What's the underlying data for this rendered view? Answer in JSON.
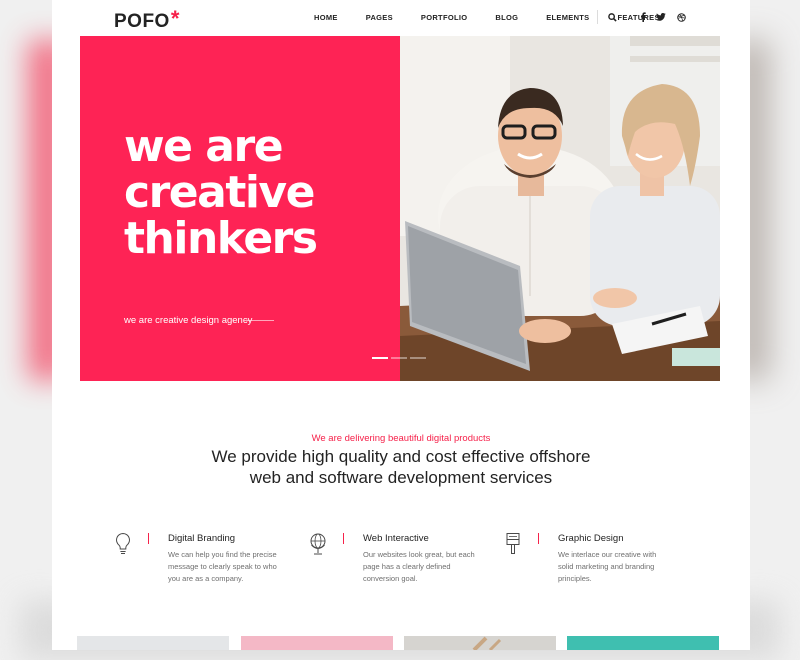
{
  "header": {
    "logo": "POFO",
    "logo_mark": "*",
    "nav": [
      "HOME",
      "PAGES",
      "PORTFOLIO",
      "BLOG",
      "ELEMENTS",
      "FEATURES"
    ],
    "icons": [
      "search-icon",
      "facebook-icon",
      "twitter-icon",
      "dribbble-icon"
    ]
  },
  "hero": {
    "title_lines": [
      "we are",
      "creative",
      "thinkers"
    ],
    "subtitle": "we are creative design agency",
    "slides": 3,
    "active_slide": 1,
    "accent_color": "#fe2355"
  },
  "intro": {
    "kicker": "We are delivering beautiful digital products",
    "title_lines": [
      "We provide high quality and cost effective offshore",
      "web and software development services"
    ]
  },
  "services": [
    {
      "icon": "lightbulb-icon",
      "title": "Digital Branding",
      "text": "We can help you find the precise message to clearly speak to who you are as a company."
    },
    {
      "icon": "globe-icon",
      "title": "Web Interactive",
      "text": "Our websites look great, but each page has a clearly defined conversion goal."
    },
    {
      "icon": "brush-icon",
      "title": "Graphic Design",
      "text": "We interlace our creative with solid marketing and branding principles."
    }
  ],
  "colors": {
    "brand": "#f6214a",
    "text": "#232323",
    "muted": "#6f6f6f"
  }
}
